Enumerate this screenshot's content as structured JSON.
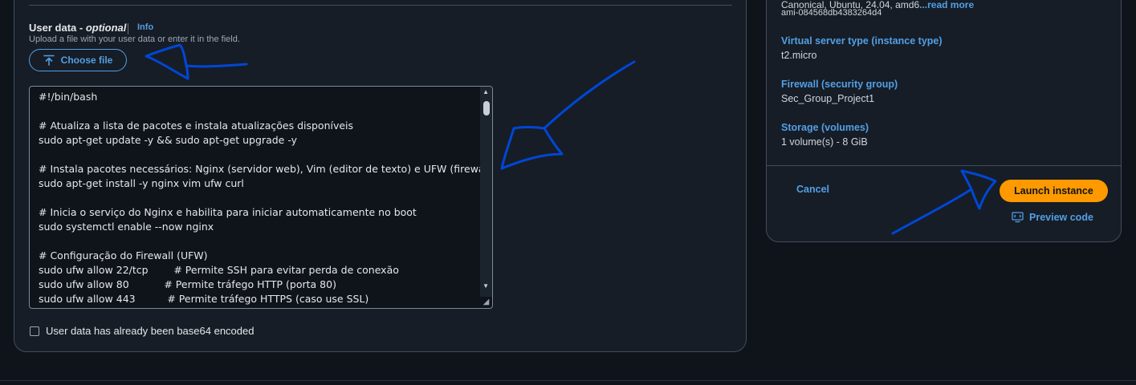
{
  "user_data": {
    "label": "User data - ",
    "optional": "optional",
    "info_link": "Info",
    "description": "Upload a file with your user data or enter it in the field.",
    "choose_file_label": "Choose file",
    "script_lines": [
      "#!/bin/bash",
      "",
      "# Atualiza a lista de pacotes e instala atualizações disponíveis",
      "sudo apt-get update -y && sudo apt-get upgrade -y",
      "",
      "# Instala pacotes necessários: Nginx (servidor web), Vim (editor de texto) e UFW (firewall)",
      "sudo apt-get install -y nginx vim ufw curl",
      "",
      "# Inicia o serviço do Nginx e habilita para iniciar automaticamente no boot",
      "sudo systemctl enable --now nginx",
      "",
      "# Configuração do Firewall (UFW)",
      "sudo ufw allow 22/tcp        # Permite SSH para evitar perda de conexão",
      "sudo ufw allow 80           # Permite tráfego HTTP (porta 80)",
      "sudo ufw allow 443          # Permite tráfego HTTPS (caso use SSL)"
    ],
    "base64_checkbox_label": "User data has already been base64 encoded",
    "base64_checked": false
  },
  "summary": {
    "image_text": "Canonical, Ubuntu, 24.04, amd6",
    "read_more": "...read more",
    "ami_id": "ami-084568db4383264d4",
    "instance_type_label": "Virtual server type (instance type)",
    "instance_type_value": "t2.micro",
    "firewall_label": "Firewall (security group)",
    "firewall_value": "Sec_Group_Project1",
    "storage_label": "Storage (volumes)",
    "storage_value": "1 volume(s) - 8 GiB"
  },
  "actions": {
    "cancel": "Cancel",
    "launch": "Launch instance",
    "preview_code": "Preview code"
  },
  "colors": {
    "accent_link": "#539fe5",
    "launch_button": "#ff9900",
    "annotation_ink": "#0047d6",
    "background": "#0f141a",
    "panel": "#161d26"
  }
}
